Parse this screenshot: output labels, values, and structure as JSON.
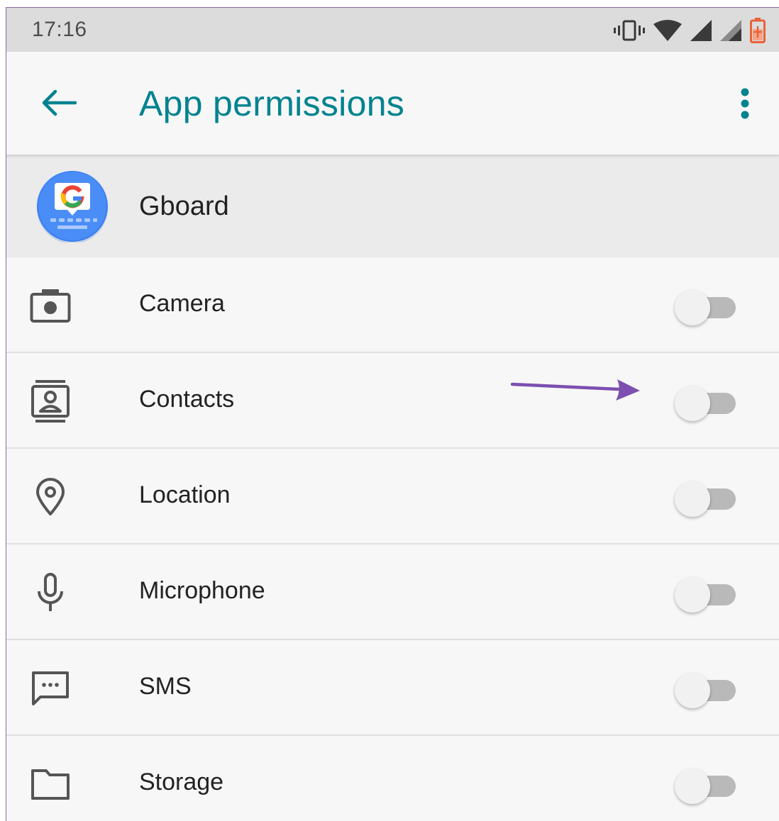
{
  "status_bar": {
    "time": "17:16",
    "icons": [
      "vibrate-icon",
      "wifi-icon",
      "signal-icon",
      "signal-icon-2",
      "battery-icon"
    ],
    "battery_color": "#e8623a"
  },
  "app_bar": {
    "title": "App permissions",
    "back_icon": "arrow-back-icon",
    "overflow_icon": "more-vert-icon",
    "accent_color": "#00838f"
  },
  "app": {
    "name": "Gboard",
    "icon": "gboard-icon",
    "icon_color": "#4285f4"
  },
  "permissions": [
    {
      "label": "Camera",
      "icon": "camera-icon",
      "enabled": false
    },
    {
      "label": "Contacts",
      "icon": "contacts-icon",
      "enabled": false
    },
    {
      "label": "Location",
      "icon": "location-icon",
      "enabled": false
    },
    {
      "label": "Microphone",
      "icon": "microphone-icon",
      "enabled": false
    },
    {
      "label": "SMS",
      "icon": "sms-icon",
      "enabled": false
    },
    {
      "label": "Storage",
      "icon": "storage-icon",
      "enabled": false
    }
  ],
  "annotation": {
    "type": "arrow",
    "target": "Contacts toggle",
    "color": "#7d4fb0"
  }
}
